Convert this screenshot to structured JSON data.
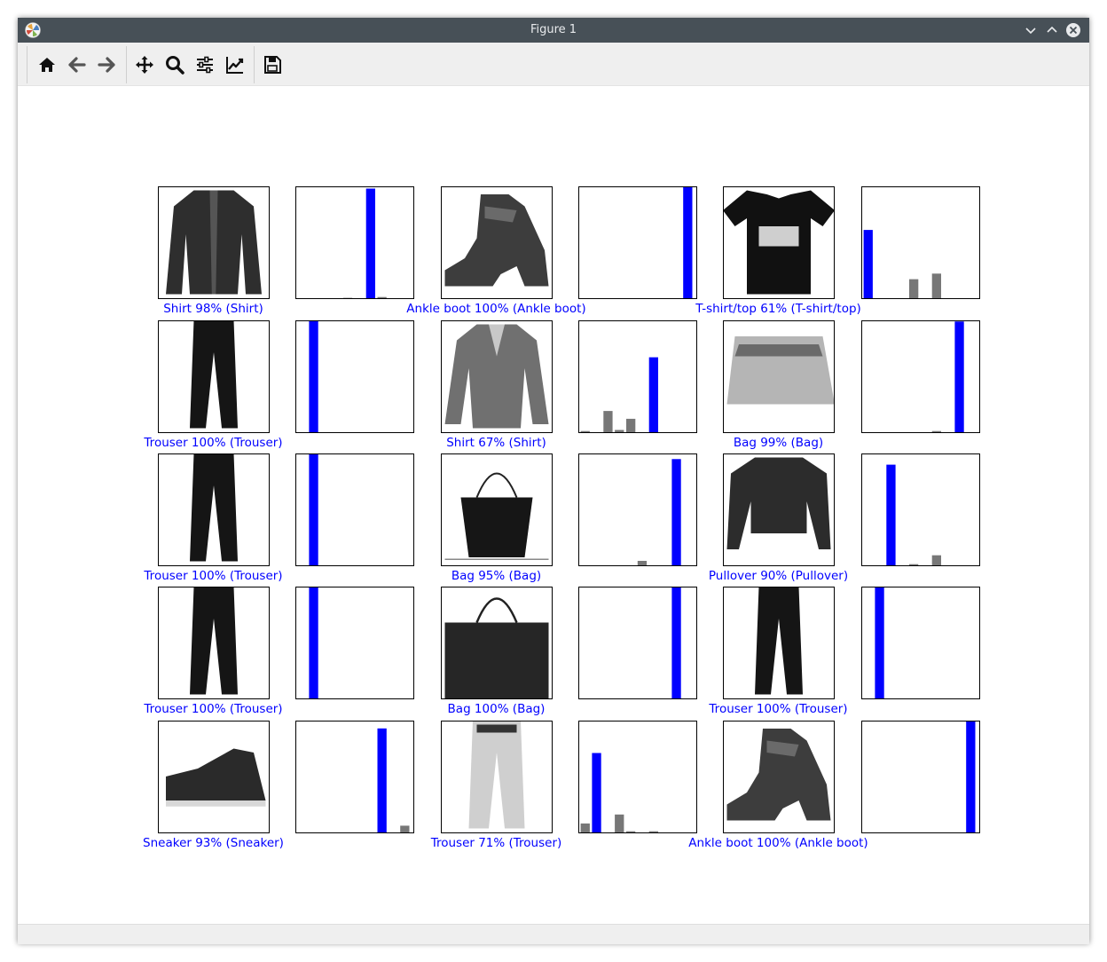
{
  "window": {
    "title": "Figure 1",
    "titlebar_color": "#475057"
  },
  "toolbar": {
    "buttons": [
      {
        "name": "home-button",
        "icon": "home-icon",
        "tooltip": "Reset original view"
      },
      {
        "name": "back-button",
        "icon": "arrow-left-icon",
        "tooltip": "Back to previous view"
      },
      {
        "name": "forward-button",
        "icon": "arrow-right-icon",
        "tooltip": "Forward to next view"
      },
      {
        "name": "pan-button",
        "icon": "move-icon",
        "tooltip": "Pan axes"
      },
      {
        "name": "zoom-button",
        "icon": "magnifier-icon",
        "tooltip": "Zoom to rectangle"
      },
      {
        "name": "subplots-button",
        "icon": "sliders-icon",
        "tooltip": "Configure subplots"
      },
      {
        "name": "customize-button",
        "icon": "line-chart-icon",
        "tooltip": "Edit axis parameters"
      },
      {
        "name": "save-button",
        "icon": "floppy-disk-icon",
        "tooltip": "Save the figure"
      }
    ]
  },
  "colors": {
    "predicted_correct": "#0000ff",
    "other_bar": "#777777",
    "label_text": "#0000ff"
  },
  "chart_data": {
    "type": "bar",
    "description_grid": "5 rows x 3 image/prediction pairs",
    "categories": [
      "0",
      "1",
      "2",
      "3",
      "4",
      "5",
      "6",
      "7",
      "8",
      "9"
    ],
    "ylim": [
      0,
      1
    ],
    "panels": [
      {
        "image": "shirt",
        "label": "Shirt 98% (Shirt)",
        "predicted": 6,
        "values": [
          0,
          0,
          0,
          0,
          0.003,
          0,
          0.98,
          0.01,
          0,
          0
        ]
      },
      {
        "image": "ankle-boot",
        "label": "Ankle boot 100% (Ankle boot)",
        "predicted": 9,
        "values": [
          0,
          0,
          0,
          0,
          0,
          0,
          0,
          0,
          0,
          1.0
        ]
      },
      {
        "image": "tshirt",
        "label": "T-shirt/top 61% (T-shirt/top)",
        "predicted": 0,
        "values": [
          0.61,
          0,
          0,
          0,
          0.17,
          0,
          0.22,
          0,
          0,
          0
        ]
      },
      {
        "image": "trouser",
        "label": "Trouser 100% (Trouser)",
        "predicted": 1,
        "values": [
          0,
          1.0,
          0,
          0,
          0,
          0,
          0,
          0,
          0,
          0
        ]
      },
      {
        "image": "shirt-gray",
        "label": "Shirt 67% (Shirt)",
        "predicted": 6,
        "values": [
          0.01,
          0,
          0.19,
          0.02,
          0.12,
          0,
          0.67,
          0,
          0,
          0
        ]
      },
      {
        "image": "bag",
        "label": "Bag 99% (Bag)",
        "predicted": 8,
        "values": [
          0,
          0,
          0,
          0,
          0,
          0,
          0.01,
          0,
          0.99,
          0
        ]
      },
      {
        "image": "trouser",
        "label": "Trouser 100% (Trouser)",
        "predicted": 1,
        "values": [
          0,
          1.0,
          0,
          0,
          0,
          0,
          0,
          0,
          0,
          0
        ]
      },
      {
        "image": "tote-bag",
        "label": "Bag 95% (Bag)",
        "predicted": 8,
        "values": [
          0,
          0,
          0,
          0,
          0,
          0.04,
          0,
          0,
          0.95,
          0
        ]
      },
      {
        "image": "pullover",
        "label": "Pullover 90% (Pullover)",
        "predicted": 2,
        "values": [
          0,
          0,
          0.9,
          0,
          0.01,
          0,
          0.09,
          0,
          0,
          0
        ]
      },
      {
        "image": "trouser",
        "label": "Trouser 100% (Trouser)",
        "predicted": 1,
        "values": [
          0,
          1.0,
          0,
          0,
          0,
          0,
          0,
          0,
          0,
          0
        ]
      },
      {
        "image": "handbag",
        "label": "Bag 100% (Bag)",
        "predicted": 8,
        "values": [
          0,
          0,
          0,
          0,
          0,
          0,
          0,
          0,
          1.0,
          0
        ]
      },
      {
        "image": "trouser",
        "label": "Trouser 100% (Trouser)",
        "predicted": 1,
        "values": [
          0,
          1.0,
          0,
          0,
          0,
          0,
          0,
          0,
          0,
          0
        ]
      },
      {
        "image": "sneaker",
        "label": "Sneaker 93% (Sneaker)",
        "predicted": 7,
        "values": [
          0,
          0,
          0,
          0,
          0,
          0,
          0,
          0.93,
          0,
          0.06
        ]
      },
      {
        "image": "trouser-light",
        "label": "Trouser 71% (Trouser)",
        "predicted": 1,
        "values": [
          0.08,
          0.71,
          0,
          0.16,
          0.01,
          0,
          0.01,
          0,
          0,
          0
        ]
      },
      {
        "image": "ankle-boot",
        "label": "Ankle boot 100% (Ankle boot)",
        "predicted": 9,
        "values": [
          0,
          0,
          0,
          0,
          0,
          0,
          0,
          0,
          0,
          1.0
        ]
      }
    ]
  }
}
